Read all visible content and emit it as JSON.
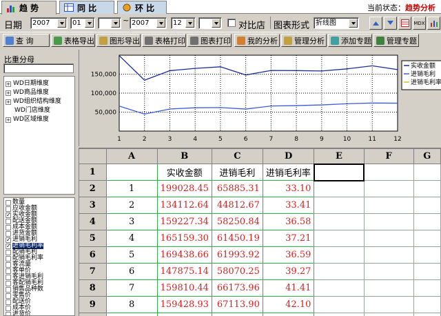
{
  "tabs": [
    {
      "label": "趋 势",
      "active": true
    },
    {
      "label": "同 比",
      "active": false
    },
    {
      "label": "环 比",
      "active": false
    }
  ],
  "status": {
    "label": "当前状态：",
    "value": "趋势分析"
  },
  "daterow": {
    "date_label": "日期",
    "year_from": "2007",
    "month_from": "01",
    "day_from": "",
    "sep": "~",
    "year_to": "2007",
    "month_to": "12",
    "day_to": "",
    "compare_store_label": "对比店",
    "chart_type_label": "图表形式",
    "chart_type_value": "折线图",
    "mdx_label": "MDX"
  },
  "toolbar": {
    "query": "查 询",
    "table_export": "表格导出",
    "chart_export": "图形导出",
    "table_print": "表格打印",
    "chart_print": "图表打印",
    "my_analysis": "我的分析",
    "manage_analysis": "管理分析",
    "add_topic": "添加专题",
    "manage_topic": "管理专题"
  },
  "left": {
    "bizhong_label": "比重分母",
    "tree": [
      {
        "label": "WD日期维度",
        "expandable": true
      },
      {
        "label": "WD商品维度",
        "expandable": true
      },
      {
        "label": "WD组织结构维度",
        "expandable": true
      },
      {
        "label": "WD门店维度",
        "expandable": false
      },
      {
        "label": "WD区域维度",
        "expandable": true
      }
    ],
    "measures": [
      {
        "label": "数量",
        "checked": false,
        "selected": false
      },
      {
        "label": "应收金额",
        "checked": false,
        "selected": false
      },
      {
        "label": "实收金额",
        "checked": true,
        "selected": false
      },
      {
        "label": "配送金额",
        "checked": false,
        "selected": false
      },
      {
        "label": "成本金额",
        "checked": false,
        "selected": false
      },
      {
        "label": "进货金额",
        "checked": false,
        "selected": false
      },
      {
        "label": "进销毛利",
        "checked": true,
        "selected": false
      },
      {
        "label": "进销毛利率",
        "checked": true,
        "selected": true
      },
      {
        "label": "配销毛利",
        "checked": false,
        "selected": false
      },
      {
        "label": "配销毛利率",
        "checked": false,
        "selected": false
      },
      {
        "label": "客流量",
        "checked": false,
        "selected": false
      },
      {
        "label": "客单价",
        "checked": false,
        "selected": false
      },
      {
        "label": "客进销毛利",
        "checked": false,
        "selected": false
      },
      {
        "label": "客配销毛利",
        "checked": false,
        "selected": false
      },
      {
        "label": "销售品种数",
        "checked": false,
        "selected": false
      },
      {
        "label": "零售价",
        "checked": false,
        "selected": false
      },
      {
        "label": "配送价",
        "checked": false,
        "selected": false
      },
      {
        "label": "成本价",
        "checked": false,
        "selected": false
      },
      {
        "label": "进货价",
        "checked": false,
        "selected": false
      }
    ]
  },
  "colors": {
    "series1": "#1a2aa0",
    "series2": "#3a5be0",
    "series3": "#d8c020",
    "value_red": "#d81f1f",
    "grid_green": "#2bb34a"
  },
  "chart_data": {
    "type": "line",
    "x": [
      1,
      2,
      3,
      4,
      5,
      6,
      7,
      8,
      9,
      10,
      11,
      12
    ],
    "ylim": [
      0,
      200000
    ],
    "yticks": [
      "50,000",
      "100,000",
      "150,000"
    ],
    "xticks": [
      "1",
      "2",
      "3",
      "4",
      "5",
      "6",
      "7",
      "8",
      "9",
      "10",
      "11",
      "12"
    ],
    "grid": true,
    "legend": "right",
    "series": [
      {
        "name": "实收金额",
        "values": [
          199028.45,
          134112.64,
          159227.34,
          165159.3,
          169438.66,
          147875.14,
          159810.44,
          159428.93,
          158389.37,
          164000,
          172000,
          162000
        ]
      },
      {
        "name": "进销毛利",
        "values": [
          65885.31,
          44812.67,
          58250.84,
          61450.19,
          61993.92,
          58070.25,
          66173.96,
          67113.9,
          68972.73,
          72000,
          74000,
          73500
        ]
      },
      {
        "name": "进销毛利率",
        "values": [
          33.1,
          33.41,
          36.58,
          37.21,
          36.59,
          39.27,
          41.41,
          42.1,
          43.55,
          44,
          43,
          45
        ]
      }
    ]
  },
  "sheet": {
    "col_headers": [
      "A",
      "B",
      "C",
      "D",
      "E",
      "F",
      "G"
    ],
    "header_row": [
      "",
      "实收金额",
      "进销毛利",
      "进销毛利率"
    ],
    "rows": [
      {
        "n": "2",
        "cells": [
          "1",
          "199028.45",
          "65885.31",
          "33.10"
        ]
      },
      {
        "n": "3",
        "cells": [
          "2",
          "134112.64",
          "44812.67",
          "33.41"
        ]
      },
      {
        "n": "4",
        "cells": [
          "3",
          "159227.34",
          "58250.84",
          "36.58"
        ]
      },
      {
        "n": "5",
        "cells": [
          "4",
          "165159.30",
          "61450.19",
          "37.21"
        ]
      },
      {
        "n": "6",
        "cells": [
          "5",
          "169438.66",
          "61993.92",
          "36.59"
        ]
      },
      {
        "n": "7",
        "cells": [
          "6",
          "147875.14",
          "58070.25",
          "39.27"
        ]
      },
      {
        "n": "8",
        "cells": [
          "7",
          "159810.44",
          "66173.96",
          "41.41"
        ]
      },
      {
        "n": "9",
        "cells": [
          "8",
          "159428.93",
          "67113.90",
          "42.10"
        ]
      },
      {
        "n": "10",
        "cells": [
          "9",
          "158389.37",
          "68972.73",
          "43.55"
        ]
      }
    ]
  }
}
